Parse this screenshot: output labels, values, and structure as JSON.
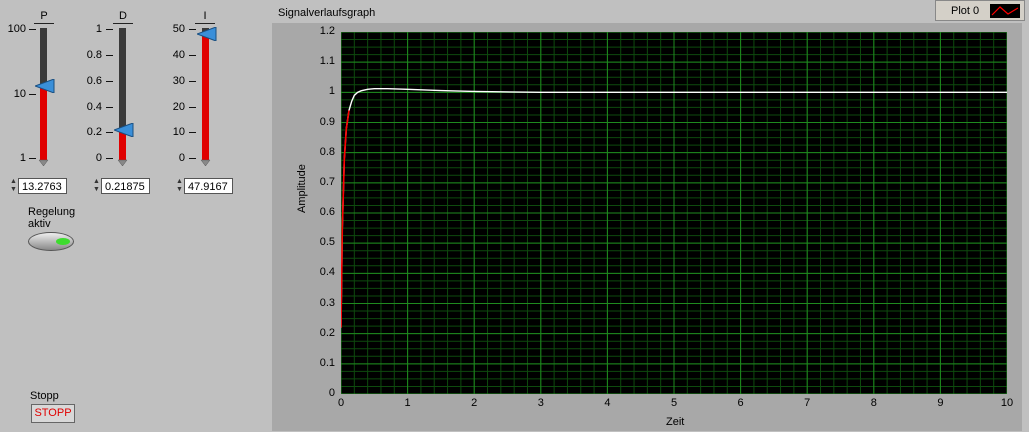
{
  "controls": {
    "p": {
      "title": "P",
      "scale": "log",
      "tick_labels": [
        "100",
        "10",
        "1"
      ],
      "value_display": "13.2763",
      "value": 13.2763
    },
    "d": {
      "title": "D",
      "scale": "linear",
      "tick_labels": [
        "1",
        "0.8",
        "0.6",
        "0.4",
        "0.2",
        "0"
      ],
      "value_display": "0.21875",
      "value": 0.21875
    },
    "i": {
      "title": "I",
      "scale": "linear",
      "tick_labels": [
        "50",
        "40",
        "30",
        "20",
        "10",
        "0"
      ],
      "value_display": "47.9167",
      "value": 47.9167
    },
    "regelung": {
      "label_line1": "Regelung",
      "label_line2": "aktiv",
      "state": "on"
    },
    "stop": {
      "label": "Stopp",
      "button_text": "STOPP"
    }
  },
  "graph": {
    "title": "Signalverlaufsgraph",
    "legend_label": "Plot 0",
    "colors": {
      "plot_background": "#000000",
      "grid_major": "#1f8a1f",
      "grid_minor": "#0e4a0e",
      "trace_main": "#ffffff",
      "trace_start": "#ff0000"
    }
  },
  "chart_data": {
    "type": "line",
    "title": "Signalverlaufsgraph",
    "xlabel": "Zeit",
    "ylabel": "Amplitude",
    "xlim": [
      0,
      10
    ],
    "ylim": [
      0,
      1.2
    ],
    "x_ticks": [
      "0",
      "1",
      "2",
      "3",
      "4",
      "5",
      "6",
      "7",
      "8",
      "9",
      "10"
    ],
    "y_ticks": [
      "0",
      "0.1",
      "0.2",
      "0.3",
      "0.4",
      "0.5",
      "0.6",
      "0.7",
      "0.8",
      "0.9",
      "1",
      "1.1",
      "1.2"
    ],
    "grid": true,
    "legend": "top-right",
    "series": [
      {
        "name": "Plot 0",
        "x": [
          0,
          0.02,
          0.05,
          0.08,
          0.12,
          0.16,
          0.2,
          0.25,
          0.3,
          0.4,
          0.5,
          0.7,
          1.0,
          1.5,
          2.0,
          3,
          4,
          5,
          6,
          7,
          8,
          9,
          10
        ],
        "y": [
          0.22,
          0.55,
          0.78,
          0.88,
          0.94,
          0.97,
          0.99,
          1.0,
          1.005,
          1.01,
          1.012,
          1.012,
          1.01,
          1.006,
          1.003,
          1.0,
          1.0,
          1.0,
          1.0,
          1.0,
          1.0,
          1.0,
          1.0
        ]
      }
    ]
  }
}
